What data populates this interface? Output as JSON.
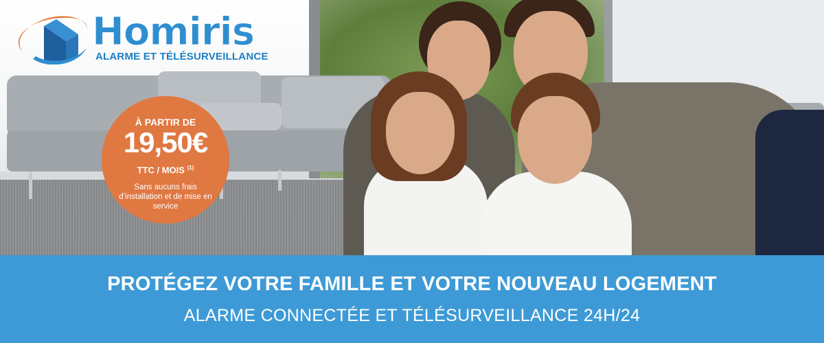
{
  "brand": {
    "name": "Homiris",
    "tagline": "ALARME ET TÉLÉSURVEILLANCE",
    "logo_icon": "house-swoosh-logo",
    "color_primary": "#2f8ed0",
    "color_swoosh": "#e8742f"
  },
  "badge": {
    "from_label": "À PARTIR DE",
    "price": "19,50€",
    "unit": "TTC / MOIS",
    "unit_ref": "(1)",
    "note": "Sans aucuns frais d’installation et de mise en service",
    "color": "#e07841"
  },
  "band": {
    "headline": "PROTÉGEZ VOTRE FAMILLE ET VOTRE NOUVEAU LOGEMENT",
    "subline": "ALARME CONNECTÉE ET TÉLÉSURVEILLANCE 24H/24",
    "color": "#3d9ad6"
  }
}
